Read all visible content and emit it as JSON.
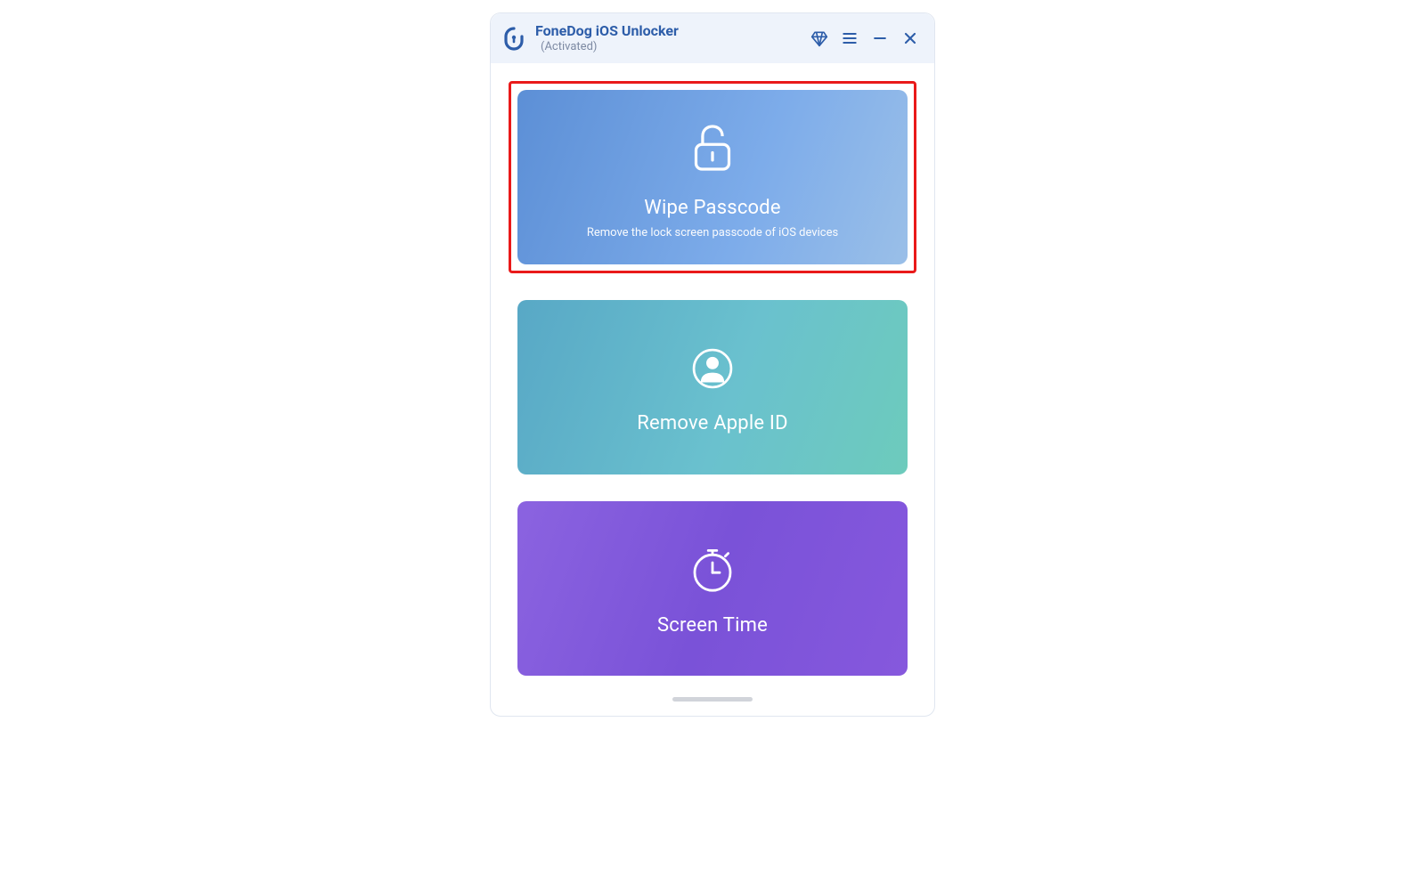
{
  "header": {
    "title": "FoneDog iOS Unlocker",
    "status": "(Activated)"
  },
  "cards": {
    "wipe": {
      "title": "Wipe Passcode",
      "subtitle": "Remove the lock screen passcode of iOS devices"
    },
    "remove": {
      "title": "Remove Apple ID"
    },
    "screen": {
      "title": "Screen Time"
    }
  }
}
